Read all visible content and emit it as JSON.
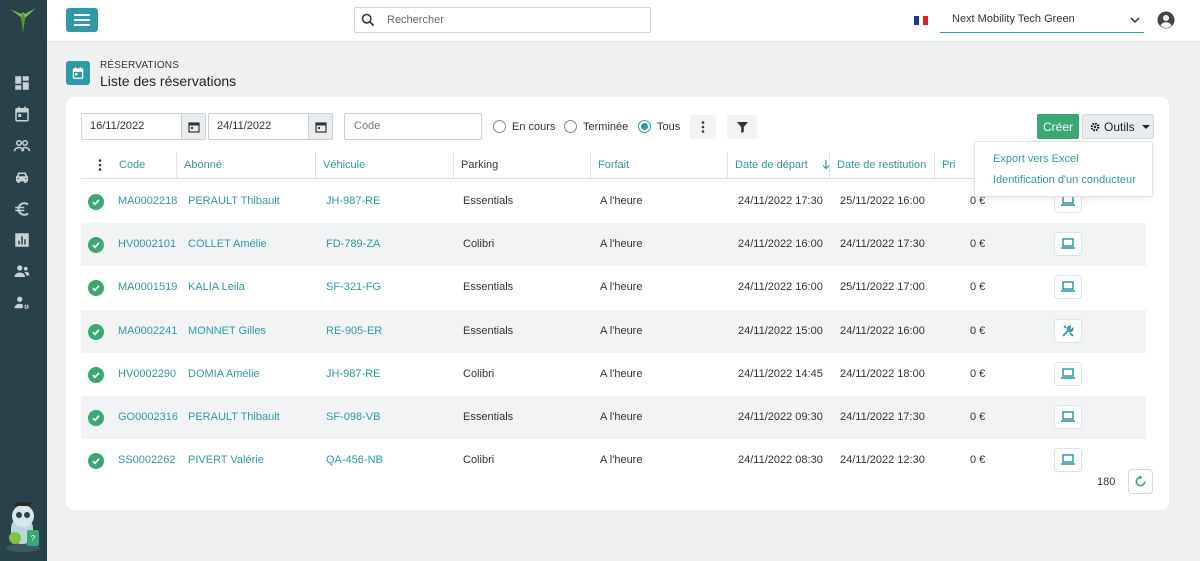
{
  "colors": {
    "sidebar": "#27424a",
    "accent": "#2f9aa6",
    "success": "#3aa872"
  },
  "topbar": {
    "search_placeholder": "Rechercher",
    "company": "Next Mobility Tech Green",
    "flag": "fr-flag-icon"
  },
  "page": {
    "breadcrumb": "RÉSERVATIONS",
    "title": "Liste des réservations"
  },
  "filters": {
    "date_from": "16/11/2022",
    "date_to": "24/11/2022",
    "code_placeholder": "Code",
    "radios": [
      {
        "label": "En cours",
        "checked": false
      },
      {
        "label": "Terminée",
        "checked": false
      },
      {
        "label": "Tous",
        "checked": true
      }
    ]
  },
  "toolbar": {
    "create_label": "Créer",
    "tools_label": "Outils"
  },
  "tools_menu": [
    "Export vers Excel",
    "Identification d'un conducteur"
  ],
  "table": {
    "columns": [
      "Code",
      "Abonné",
      "Véhicule",
      "Parking",
      "Forfait",
      "Date de départ",
      "Date de restitution",
      "Pri"
    ],
    "rows": [
      {
        "code": "MA0002218",
        "abonne": "PERAULT Thibault",
        "vehicule": "JH-987-RE",
        "parking": "Essentials",
        "forfait": "A l'heure",
        "depart": "24/11/2022 17:30",
        "restitution": "25/11/2022 16:00",
        "prix": "0 €",
        "action": "laptop-icon"
      },
      {
        "code": "HV0002101",
        "abonne": "COLLET Amélie",
        "vehicule": "FD-789-ZA",
        "parking": "Colibri",
        "forfait": "A l'heure",
        "depart": "24/11/2022 16:00",
        "restitution": "24/11/2022 17:30",
        "prix": "0 €",
        "action": "laptop-icon"
      },
      {
        "code": "MA0001519",
        "abonne": "KALIA Leila",
        "vehicule": "SF-321-FG",
        "parking": "Essentials",
        "forfait": "A l'heure",
        "depart": "24/11/2022 16:00",
        "restitution": "25/11/2022 17:00",
        "prix": "0 €",
        "action": "laptop-icon"
      },
      {
        "code": "MA0002241",
        "abonne": "MONNET Gilles",
        "vehicule": "RE-905-ER",
        "parking": "Essentials",
        "forfait": "A l'heure",
        "depart": "24/11/2022 15:00",
        "restitution": "24/11/2022 16:00",
        "prix": "0 €",
        "action": "tools-icon"
      },
      {
        "code": "HV0002290",
        "abonne": "DOMIA Amélie",
        "vehicule": "JH-987-RE",
        "parking": "Colibri",
        "forfait": "A l'heure",
        "depart": "24/11/2022 14:45",
        "restitution": "24/11/2022 18:00",
        "prix": "0 €",
        "action": "laptop-icon"
      },
      {
        "code": "GO0002316",
        "abonne": "PERAULT Thibault",
        "vehicule": "SF-098-VB",
        "parking": "Essentials",
        "forfait": "A l'heure",
        "depart": "24/11/2022 09:30",
        "restitution": "24/11/2022 17:30",
        "prix": "0 €",
        "action": "laptop-icon"
      },
      {
        "code": "SS0002262",
        "abonne": "PIVERT Valérie",
        "vehicule": "QA-456-NB",
        "parking": "Colibri",
        "forfait": "A l'heure",
        "depart": "24/11/2022 08:30",
        "restitution": "24/11/2022 12:30",
        "prix": "0 €",
        "action": "laptop-icon"
      }
    ],
    "total": "180"
  }
}
